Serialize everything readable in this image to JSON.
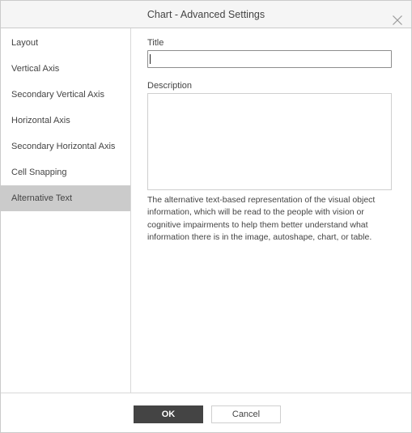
{
  "dialog": {
    "title": "Chart - Advanced Settings",
    "close_icon": "close-icon"
  },
  "sidebar": {
    "items": [
      {
        "label": "Layout",
        "active": false
      },
      {
        "label": "Vertical Axis",
        "active": false
      },
      {
        "label": "Secondary Vertical Axis",
        "active": false
      },
      {
        "label": "Horizontal Axis",
        "active": false
      },
      {
        "label": "Secondary Horizontal Axis",
        "active": false
      },
      {
        "label": "Cell Snapping",
        "active": false
      },
      {
        "label": "Alternative Text",
        "active": true
      }
    ]
  },
  "content": {
    "title_label": "Title",
    "title_value": "",
    "description_label": "Description",
    "description_value": "",
    "hint": "The alternative text-based representation of the visual object information, which will be read to the people with vision or cognitive impairments to help them better understand what information there is in the image, autoshape, chart, or table."
  },
  "footer": {
    "ok_label": "OK",
    "cancel_label": "Cancel"
  }
}
